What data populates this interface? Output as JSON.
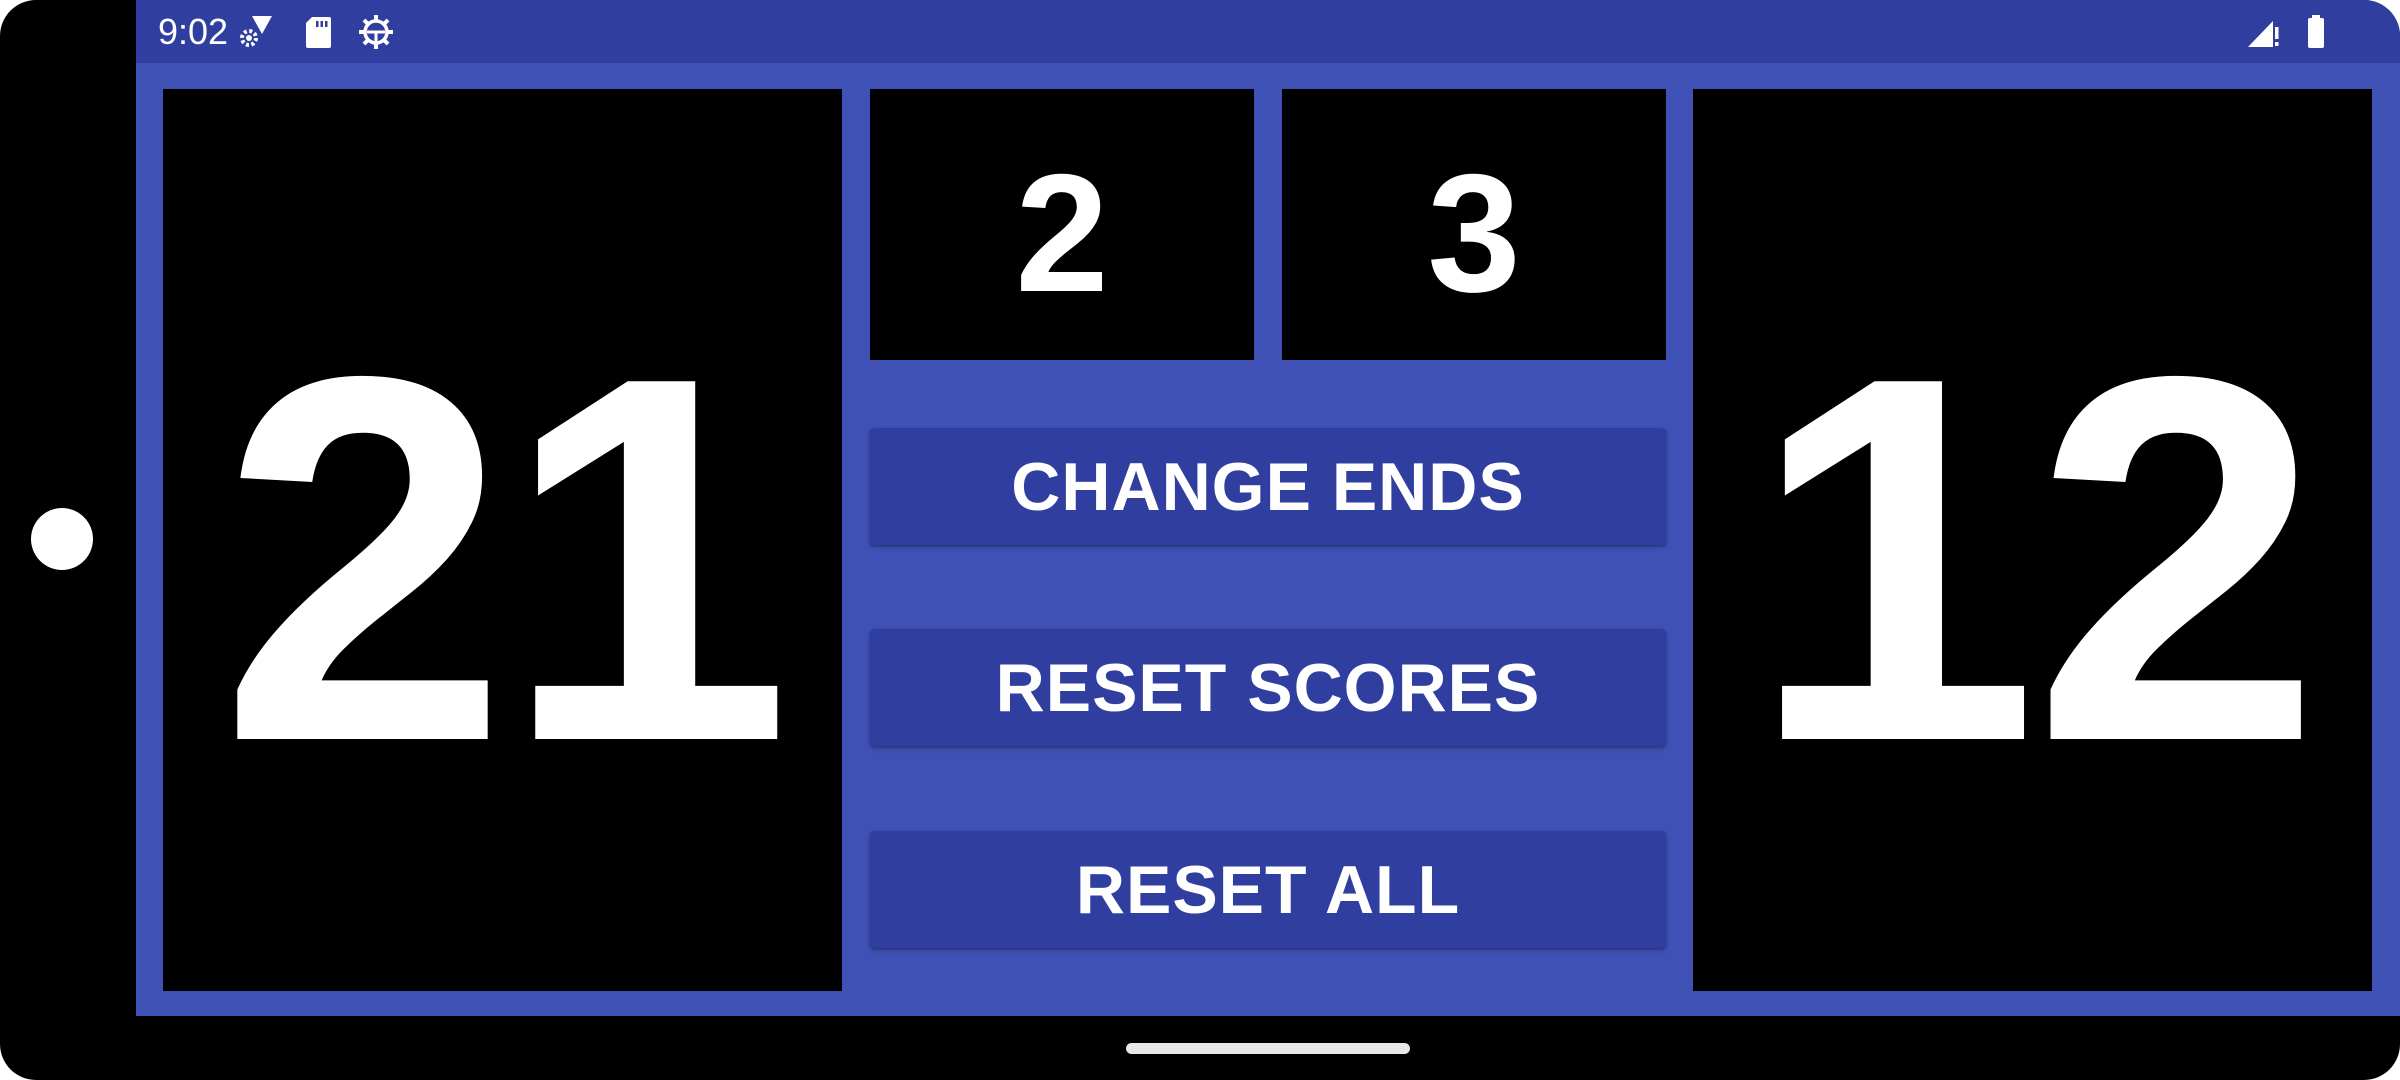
{
  "status_bar": {
    "time": "9:02",
    "left_icons": [
      "wifi-settings-icon",
      "sd-card-icon",
      "android-debug-gear-icon"
    ],
    "right_icons": [
      "signal-no-service-icon",
      "battery-full-icon"
    ]
  },
  "scoreboard": {
    "left_score": "21",
    "right_score": "12",
    "left_games": "2",
    "right_games": "3"
  },
  "buttons": {
    "change_ends": "CHANGE ENDS",
    "reset_scores": "RESET SCORES",
    "reset_all": "RESET ALL"
  },
  "colors": {
    "primary": "#3f51b5",
    "primary_dark": "#303f9f",
    "panel": "#000000",
    "text": "#ffffff"
  }
}
